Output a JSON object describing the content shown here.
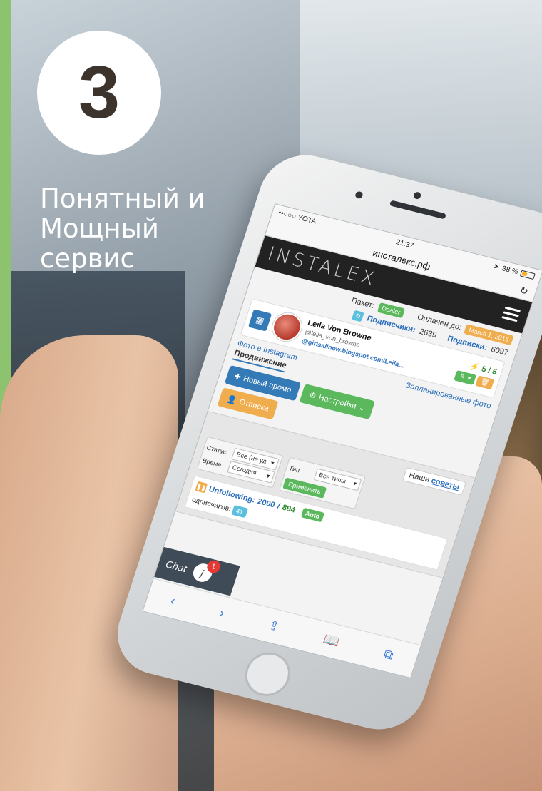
{
  "promo": {
    "step": "3",
    "headline": [
      "Понятный и",
      "Мощный",
      "сервис"
    ]
  },
  "status_bar": {
    "carrier": "••○○○ YOTA",
    "time": "21:37",
    "battery": "38 %"
  },
  "browser": {
    "url": "инсталекс.рф"
  },
  "app": {
    "brand": "INSTALEX",
    "package_label": "Пакет:",
    "package_value": "Dealer",
    "paid_label": "Оплачен до:",
    "paid_value": "March 1, 2016",
    "followers_label": "Подписчики:",
    "followers_value": "2639",
    "following_label": "Подписки:",
    "following_value": "6097"
  },
  "profile": {
    "name": "Leila Von Browne",
    "handle": "@leila_von_browne",
    "link": "@girlsallnow.blogspot.com/Leila...",
    "limit": "5 / 5"
  },
  "tabs": {
    "photos": "Фото в Instagram",
    "scheduled": "Запланированные фото",
    "active": "Продвижение"
  },
  "buttons": {
    "new_promo": "Новый промо",
    "settings": "Настройки",
    "unsubscribe": "Отписка"
  },
  "filters": {
    "tips_prefix": "Наши",
    "tips_link": "советы",
    "status_label": "Статус",
    "status_value": "Все (не уд",
    "time_label": "Время",
    "time_value": "Сегодня",
    "type_label": "Тип",
    "type_value": "Все типы",
    "apply": "Применить"
  },
  "task": {
    "title": "Unfollowing:",
    "done": "2000",
    "separator": " / ",
    "total": "894",
    "auto": "Auto",
    "followers_line": "одписчиков:",
    "followers_badge": "41"
  },
  "chat": {
    "label": "Chat",
    "avatar_letter": "j",
    "badge": "1"
  },
  "colors": {
    "stripe": "#8dc26f",
    "primary": "#337ab7",
    "success": "#5cb85c",
    "warning": "#f0ad4e",
    "header": "#222222"
  }
}
